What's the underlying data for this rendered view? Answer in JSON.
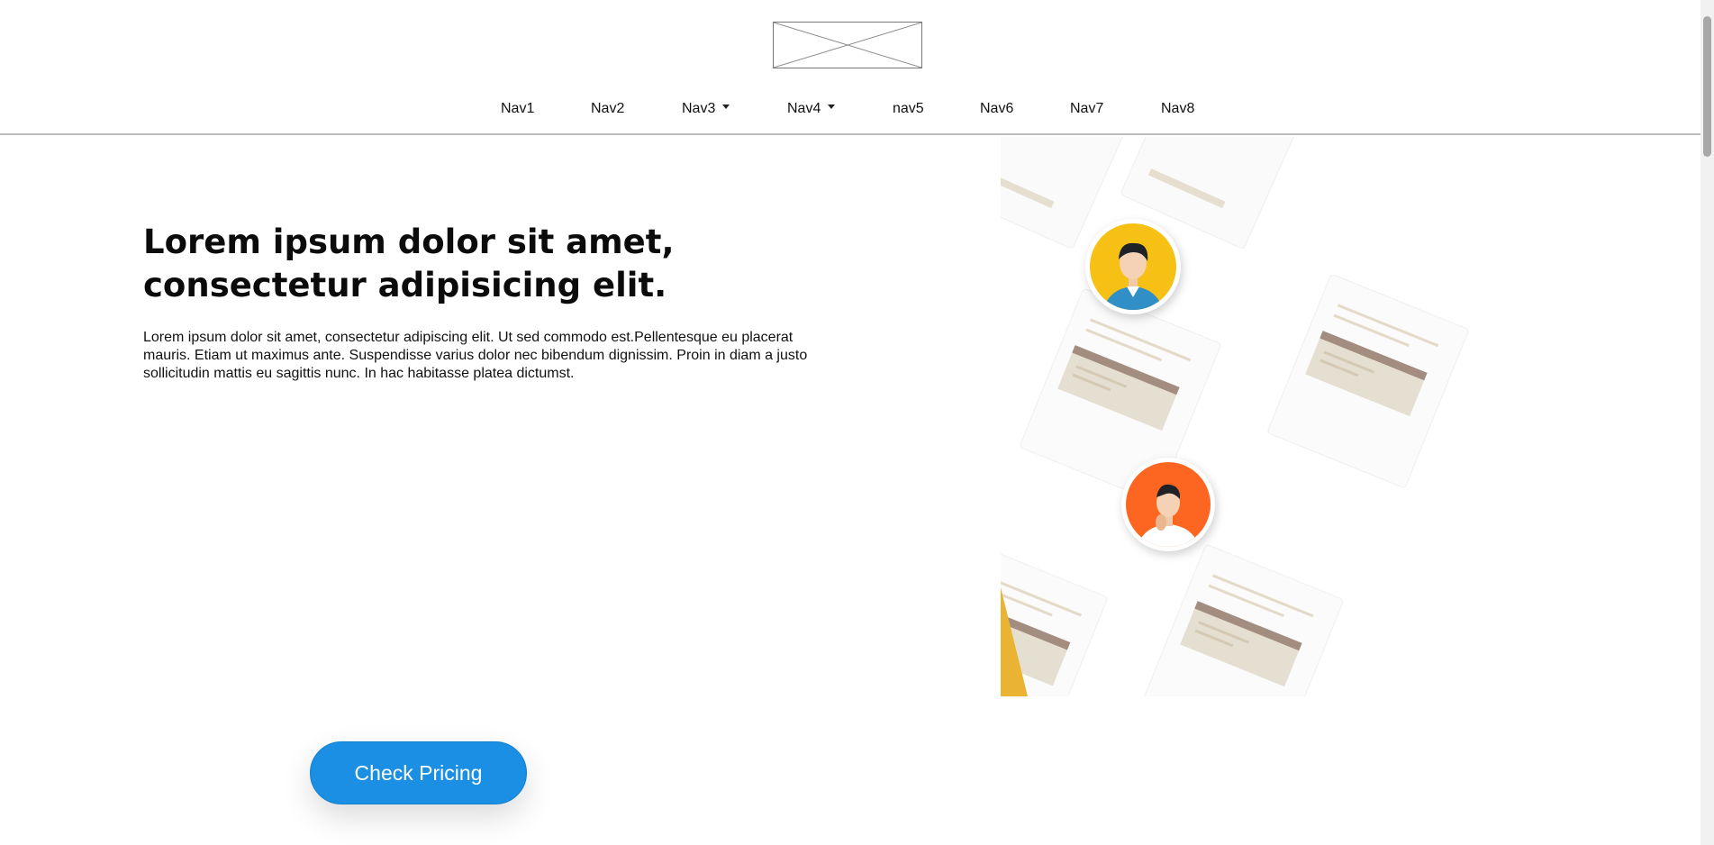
{
  "header": {
    "logo_icon": "image-placeholder-icon",
    "nav": [
      {
        "label": "Nav1",
        "dropdown": false
      },
      {
        "label": "Nav2",
        "dropdown": false
      },
      {
        "label": "Nav3",
        "dropdown": true
      },
      {
        "label": "Nav4",
        "dropdown": true
      },
      {
        "label": "nav5",
        "dropdown": false
      },
      {
        "label": "Nav6",
        "dropdown": false
      },
      {
        "label": "Nav7",
        "dropdown": false
      },
      {
        "label": "Nav8",
        "dropdown": false
      }
    ]
  },
  "hero": {
    "title": "Lorem ipsum dolor sit amet, consectetur adipisicing elit.",
    "text": "Lorem ipsum dolor sit amet, consectetur adipiscing elit. Ut sed commodo est.Pellentesque eu placerat mauris. Etiam ut maximus ante. Suspendisse varius dolor nec bibendum dignissim. Proin in diam a justo sollicitudin mattis eu sagittis nunc. In hac habitasse platea dictumst.",
    "illustration_icon": "profile-cards-illustration",
    "cta_label": "Check Pricing"
  },
  "colors": {
    "accent": "#1a8fe3",
    "avatar_yellow": "#f6c114",
    "avatar_orange": "#fd6621"
  }
}
